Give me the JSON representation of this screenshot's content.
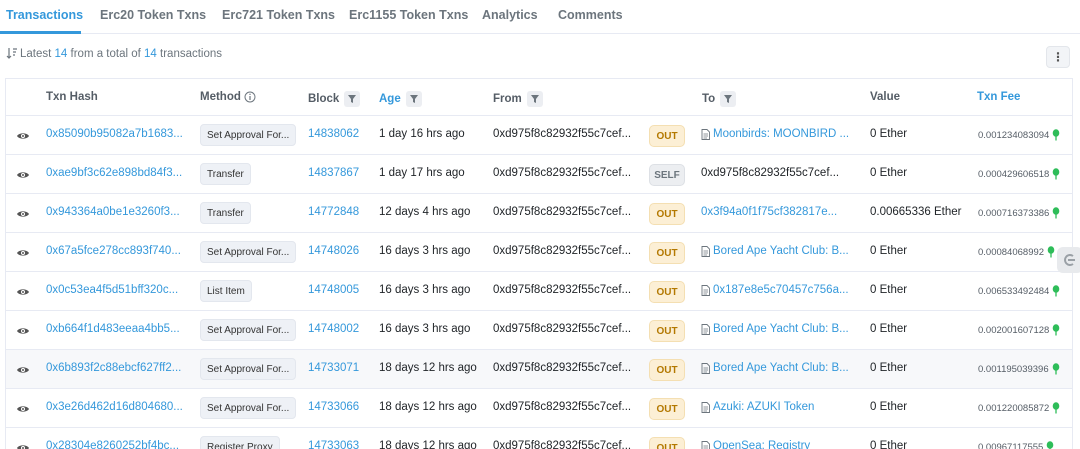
{
  "tabs": [
    {
      "label": "Transactions",
      "active": true
    },
    {
      "label": "Erc20 Token Txns"
    },
    {
      "label": "Erc721 Token Txns"
    },
    {
      "label": "Erc1155 Token Txns"
    },
    {
      "label": "Analytics"
    },
    {
      "label": "Comments"
    }
  ],
  "summary": {
    "prefix": "Latest ",
    "latest": "14",
    "middle": " from a total of ",
    "total": "14",
    "suffix": " transactions"
  },
  "more_button": {
    "label": "⋮",
    "icon": "more-vertical-icon"
  },
  "columns": {
    "txn_hash": "Txn Hash",
    "method": "Method",
    "block": "Block",
    "age": "Age",
    "from": "From",
    "to": "To",
    "value": "Value",
    "txn_fee": "Txn Fee"
  },
  "colors": {
    "accent": "#3498db",
    "out_bg": "#fcefd5",
    "out_text": "#b37800",
    "self_bg": "#eceef1",
    "fee_icon": "#2ebd59"
  },
  "rows": [
    {
      "hash": "0x85090b95082a7b1683...",
      "method": "Set Approval For...",
      "block": "14838062",
      "age": "1 day 16 hrs ago",
      "from": "0xd975f8c82932f55c7cef...",
      "direction": "OUT",
      "to": "Moonbirds: MOONBIRD ...",
      "to_contract": true,
      "to_link": true,
      "value": "0 Ether",
      "fee": "0.001234083094"
    },
    {
      "hash": "0xae9bf3c62e898bd84f3...",
      "method": "Transfer",
      "block": "14837867",
      "age": "1 day 17 hrs ago",
      "from": "0xd975f8c82932f55c7cef...",
      "direction": "SELF",
      "to": "0xd975f8c82932f55c7cef...",
      "to_contract": false,
      "to_link": false,
      "value": "0 Ether",
      "fee": "0.000429606518"
    },
    {
      "hash": "0x943364a0be1e3260f3...",
      "method": "Transfer",
      "block": "14772848",
      "age": "12 days 4 hrs ago",
      "from": "0xd975f8c82932f55c7cef...",
      "direction": "OUT",
      "to": "0x3f94a0f1f75cf382817e...",
      "to_contract": false,
      "to_link": true,
      "value": "0.00665336 Ether",
      "fee": "0.000716373386"
    },
    {
      "hash": "0x67a5fce278cc893f740...",
      "method": "Set Approval For...",
      "block": "14748026",
      "age": "16 days 3 hrs ago",
      "from": "0xd975f8c82932f55c7cef...",
      "direction": "OUT",
      "to": "Bored Ape Yacht Club: B...",
      "to_contract": true,
      "to_link": true,
      "value": "0 Ether",
      "fee": "0.00084068992"
    },
    {
      "hash": "0x0c53ea4f5d51bff320c...",
      "method": "List Item",
      "block": "14748005",
      "age": "16 days 3 hrs ago",
      "from": "0xd975f8c82932f55c7cef...",
      "direction": "OUT",
      "to": "0x187e8e5c70457c756a...",
      "to_contract": true,
      "to_link": true,
      "value": "0 Ether",
      "fee": "0.006533492484"
    },
    {
      "hash": "0xb664f1d483eeaa4bb5...",
      "method": "Set Approval For...",
      "block": "14748002",
      "age": "16 days 3 hrs ago",
      "from": "0xd975f8c82932f55c7cef...",
      "direction": "OUT",
      "to": "Bored Ape Yacht Club: B...",
      "to_contract": true,
      "to_link": true,
      "value": "0 Ether",
      "fee": "0.002001607128"
    },
    {
      "hash": "0x6b893f2c88ebcf627ff2...",
      "method": "Set Approval For...",
      "block": "14733071",
      "age": "18 days 12 hrs ago",
      "from": "0xd975f8c82932f55c7cef...",
      "direction": "OUT",
      "to": "Bored Ape Yacht Club: B...",
      "to_contract": true,
      "to_link": true,
      "value": "0 Ether",
      "fee": "0.001195039396",
      "highlight": true
    },
    {
      "hash": "0x3e26d462d16d804680...",
      "method": "Set Approval For...",
      "block": "14733066",
      "age": "18 days 12 hrs ago",
      "from": "0xd975f8c82932f55c7cef...",
      "direction": "OUT",
      "to": "Azuki: AZUKI Token",
      "to_contract": true,
      "to_link": true,
      "value": "0 Ether",
      "fee": "0.001220085872"
    },
    {
      "hash": "0x28304e8260252bf4bc...",
      "method": "Register Proxy",
      "block": "14733063",
      "age": "18 days 12 hrs ago",
      "from": "0xd975f8c82932f55c7cef...",
      "direction": "OUT",
      "to": "OpenSea: Registry",
      "to_contract": true,
      "to_link": true,
      "value": "0 Ether",
      "fee": "0.00967117555"
    }
  ]
}
